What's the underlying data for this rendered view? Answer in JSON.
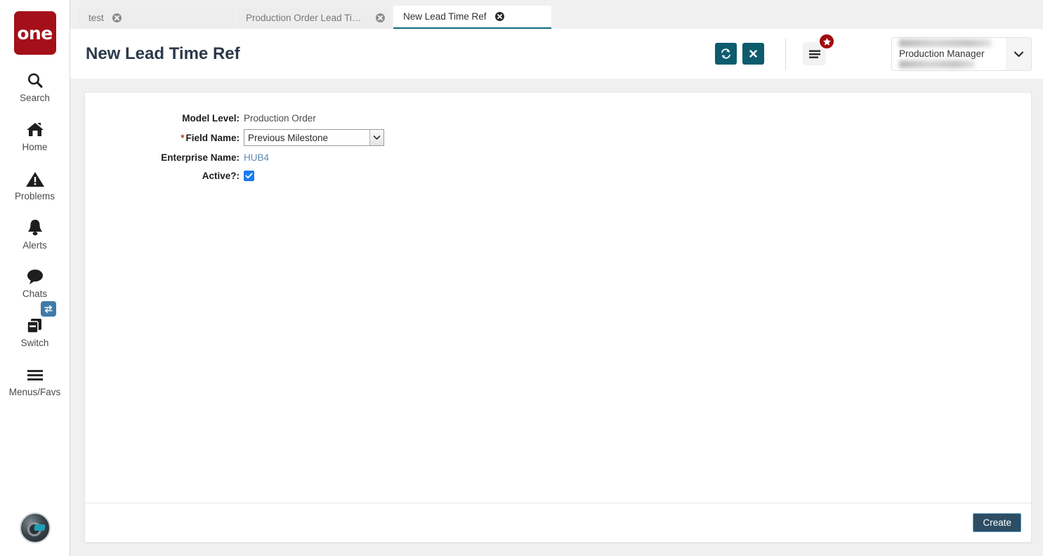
{
  "sidebar": {
    "logo_text": "one",
    "items": [
      {
        "label": "Search",
        "icon": "search-icon"
      },
      {
        "label": "Home",
        "icon": "home-icon"
      },
      {
        "label": "Problems",
        "icon": "warning-triangle-icon"
      },
      {
        "label": "Alerts",
        "icon": "bell-icon"
      },
      {
        "label": "Chats",
        "icon": "chat-bubble-icon"
      },
      {
        "label": "Switch",
        "icon": "switch-cards-icon"
      },
      {
        "label": "Menus/Favs",
        "icon": "hamburger-icon"
      }
    ]
  },
  "tabs": [
    {
      "title": "test",
      "active": false
    },
    {
      "title": "Production Order Lead Time Ref...",
      "active": false
    },
    {
      "title": "New Lead Time Ref",
      "active": true
    }
  ],
  "header": {
    "title": "New Lead Time Ref",
    "refresh_icon": "refresh-icon",
    "close_icon": "close-x-icon",
    "menu_icon": "hamburger-menu-icon",
    "star_badge_icon": "star-icon",
    "user": {
      "role": "Production Manager",
      "caret_icon": "chevron-down-icon"
    }
  },
  "form": {
    "fields": [
      {
        "label": "Model Level:",
        "required": false,
        "type": "text",
        "value": "Production Order"
      },
      {
        "label": "Field Name:",
        "required": true,
        "type": "select",
        "value": "Previous Milestone"
      },
      {
        "label": "Enterprise Name:",
        "required": false,
        "type": "link",
        "value": "HUB4"
      },
      {
        "label": "Active?:",
        "required": false,
        "type": "checkbox",
        "value": "checked"
      }
    ]
  },
  "footer": {
    "create_label": "Create"
  },
  "colors": {
    "brand_red": "#a50f19",
    "teal_button": "#0d5c6e",
    "active_tab_underline": "#0d6b7d",
    "badge_red": "#9e0b10",
    "checkbox_blue": "#1a7cf0",
    "create_button": "#2c4d63",
    "link_blue": "#5a8bb5"
  }
}
